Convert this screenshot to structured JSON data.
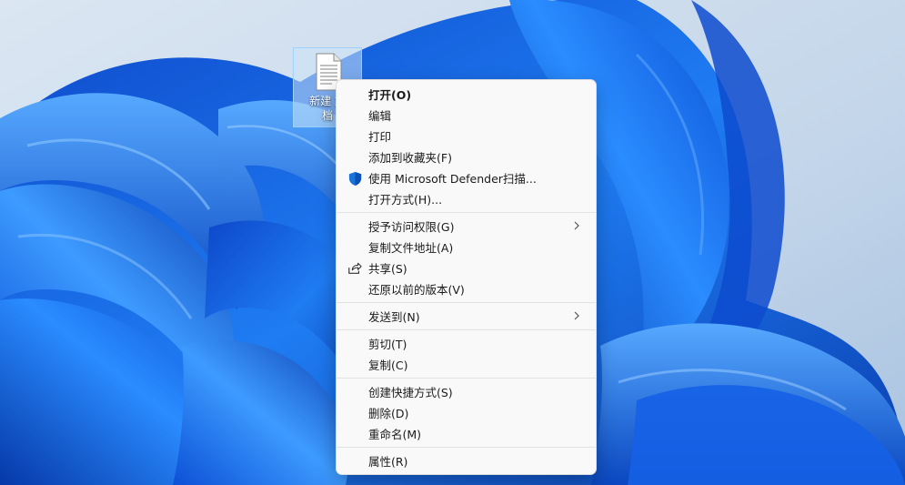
{
  "desktop": {
    "file": {
      "name": "新建 文本文档",
      "label_line1": "新建 文",
      "label_line2": "档",
      "icon": "text-file-icon"
    }
  },
  "context_menu": {
    "groups": [
      [
        {
          "label": "打开(O)",
          "bold": true
        },
        {
          "label": "编辑"
        },
        {
          "label": "打印"
        },
        {
          "label": "添加到收藏夹(F)"
        },
        {
          "label": "使用 Microsoft Defender扫描...",
          "icon": "defender-shield-icon"
        },
        {
          "label": "打开方式(H)..."
        }
      ],
      [
        {
          "label": "授予访问权限(G)",
          "submenu": true
        },
        {
          "label": "复制文件地址(A)"
        },
        {
          "label": "共享(S)",
          "icon": "share-icon"
        },
        {
          "label": "还原以前的版本(V)"
        }
      ],
      [
        {
          "label": "发送到(N)",
          "submenu": true
        }
      ],
      [
        {
          "label": "剪切(T)"
        },
        {
          "label": "复制(C)"
        }
      ],
      [
        {
          "label": "创建快捷方式(S)"
        },
        {
          "label": "删除(D)"
        },
        {
          "label": "重命名(M)"
        }
      ],
      [
        {
          "label": "属性(R)"
        }
      ]
    ]
  },
  "colors": {
    "menu_background": "#f9f9f9",
    "defender_blue": "#1a73d9",
    "wallpaper_blue": "#0a5ce0"
  }
}
